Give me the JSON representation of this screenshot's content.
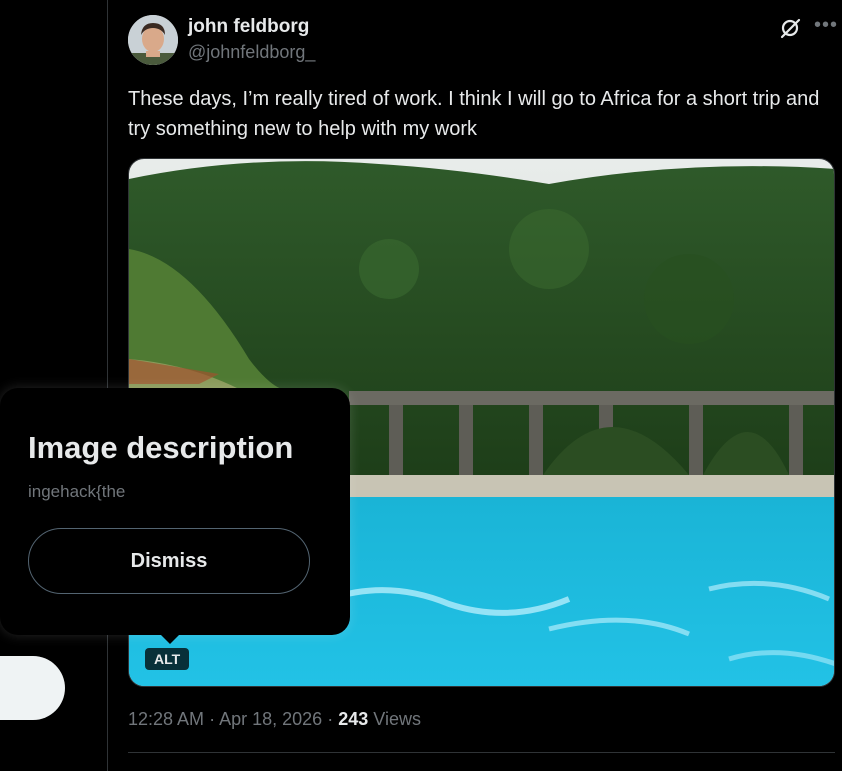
{
  "tweet": {
    "author_name": "john feldborg",
    "author_handle": "@johnfeldborg_",
    "text": "These days, I’m really tired of work. I think I will go to Africa for a short trip and try something new to help with my work",
    "alt_badge": "ALT",
    "time": "12:28 AM",
    "separator": "·",
    "date": "Apr 18, 2026",
    "views_count": "243",
    "views_label": "Views"
  },
  "popover": {
    "title": "Image description",
    "description": "ingehack{the",
    "dismiss_label": "Dismiss"
  },
  "icons": {
    "grok": "grok-icon",
    "more": "more-icon"
  },
  "colors": {
    "background": "#000000",
    "text": "#e7e9ea",
    "muted": "#71767b",
    "border": "#2f3336"
  }
}
